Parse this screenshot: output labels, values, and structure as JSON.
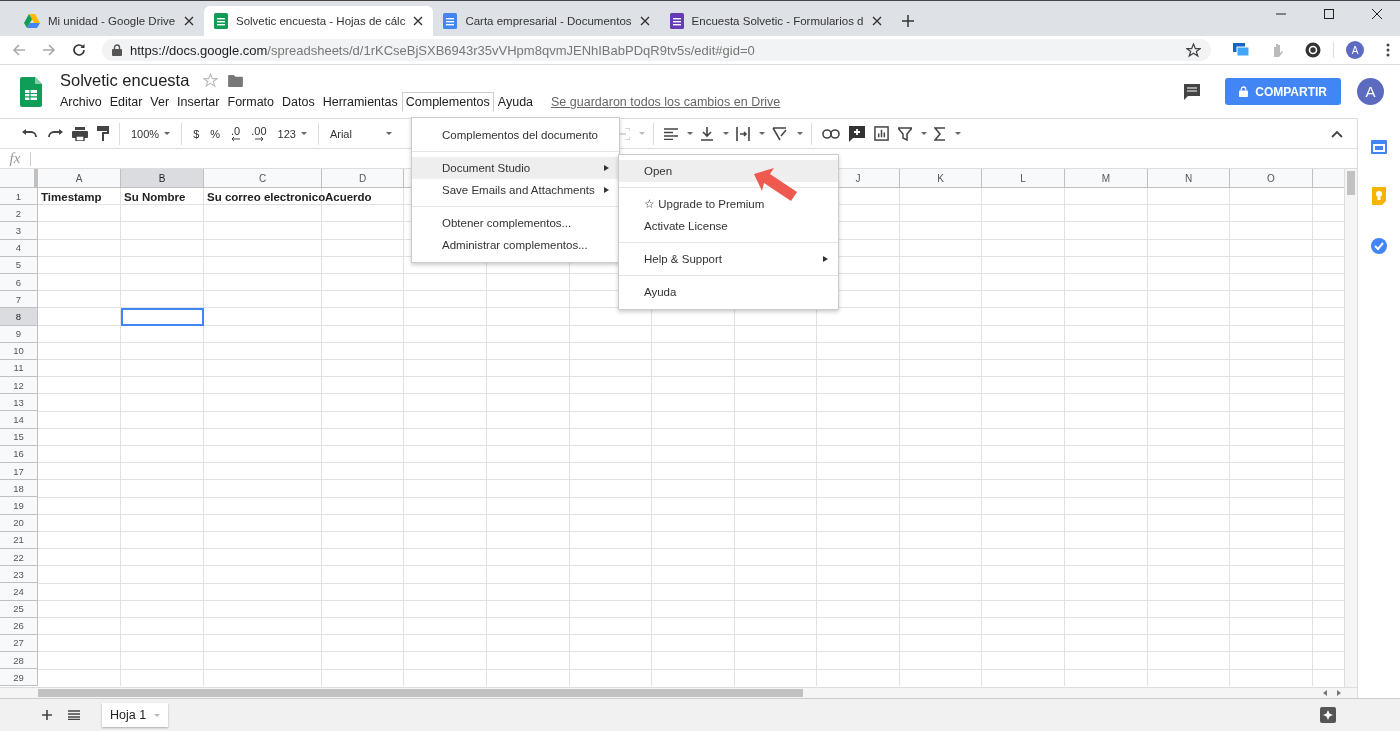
{
  "browser": {
    "tabs": [
      {
        "kind": "drive",
        "title": "Mi unidad - Google Drive",
        "selected": false
      },
      {
        "kind": "sheets",
        "title": "Solvetic encuesta - Hojas de cálc",
        "selected": true
      },
      {
        "kind": "docs",
        "title": "Carta empresarial - Documentos",
        "selected": false
      },
      {
        "kind": "forms",
        "title": "Encuesta Solvetic - Formularios d",
        "selected": false
      }
    ],
    "address": {
      "host": "https://docs.google.com",
      "path": "/spreadsheets/d/1rKCseBjSXB6943r35vVHpm8qvmJENhIBabPDqR9tv5s/edit#gid=0"
    },
    "profile": "A"
  },
  "app": {
    "title": "Solvetic encuesta",
    "menu": [
      {
        "label": "Archivo",
        "open": false
      },
      {
        "label": "Editar",
        "open": false
      },
      {
        "label": "Ver",
        "open": false
      },
      {
        "label": "Insertar",
        "open": false
      },
      {
        "label": "Formato",
        "open": false
      },
      {
        "label": "Datos",
        "open": false
      },
      {
        "label": "Herramientas",
        "open": false
      },
      {
        "label": "Complementos",
        "open": true
      },
      {
        "label": "Ayuda",
        "open": false
      }
    ],
    "save_status": "Se guardaron todos los cambios en Drive",
    "share_button": "COMPARTIR",
    "avatar": "A"
  },
  "toolbar": {
    "zoom": "100%",
    "currency": "$",
    "percent": "%",
    "decrease_decimals": ".0",
    "increase_decimals": ".00",
    "number_format": "123",
    "font": "Arial"
  },
  "formula_bar": {
    "label": "fx"
  },
  "grid": {
    "columns": [
      {
        "label": "A",
        "selected": false
      },
      {
        "label": "B",
        "selected": true
      },
      {
        "label": "C",
        "selected": false
      },
      {
        "label": "D",
        "selected": false
      },
      {
        "covered": true
      },
      {
        "label": "J",
        "selected": false
      },
      {
        "label": "K",
        "selected": false
      },
      {
        "label": "L",
        "selected": false
      },
      {
        "label": "M",
        "selected": false
      },
      {
        "label": "N",
        "selected": false
      },
      {
        "label": "O",
        "selected": false
      },
      {
        "covered": true
      }
    ],
    "rows": [
      {
        "number": "1",
        "selected": false,
        "bold": true,
        "cells": [
          "Timestamp",
          "Su Nombre",
          "Su correo electronico",
          "Acuerdo"
        ]
      },
      {
        "number": "2",
        "selected": false
      },
      {
        "number": "3",
        "selected": false
      },
      {
        "number": "4",
        "selected": false
      },
      {
        "number": "5",
        "selected": false
      },
      {
        "number": "6",
        "selected": false
      },
      {
        "number": "7",
        "selected": false
      },
      {
        "number": "8",
        "selected": true
      },
      {
        "number": "9",
        "selected": false
      },
      {
        "number": "10",
        "selected": false
      },
      {
        "number": "11",
        "selected": false
      },
      {
        "number": "12",
        "selected": false
      },
      {
        "number": "13",
        "selected": false
      },
      {
        "number": "14",
        "selected": false
      },
      {
        "number": "15",
        "selected": false
      },
      {
        "number": "16",
        "selected": false
      },
      {
        "number": "17",
        "selected": false
      },
      {
        "number": "18",
        "selected": false
      },
      {
        "number": "19",
        "selected": false
      },
      {
        "number": "20",
        "selected": false
      },
      {
        "number": "21",
        "selected": false
      },
      {
        "number": "22",
        "selected": false
      },
      {
        "number": "23",
        "selected": false
      },
      {
        "number": "24",
        "selected": false
      },
      {
        "number": "25",
        "selected": false
      },
      {
        "number": "26",
        "selected": false
      },
      {
        "number": "27",
        "selected": false
      },
      {
        "number": "28",
        "selected": false
      },
      {
        "number": "29",
        "selected": false
      }
    ]
  },
  "addon_menu": {
    "items": [
      {
        "kind": "item",
        "label": "Complementos del documento",
        "highlighted": false,
        "has_submenu": false
      },
      {
        "kind": "separator"
      },
      {
        "kind": "item",
        "label": "Document Studio",
        "highlighted": true,
        "has_submenu": true
      },
      {
        "kind": "item",
        "label": "Save Emails and Attachments",
        "highlighted": false,
        "has_submenu": true
      },
      {
        "kind": "separator"
      },
      {
        "kind": "item",
        "label": "Obtener complementos...",
        "highlighted": false,
        "has_submenu": false
      },
      {
        "kind": "item",
        "label": "Administrar complementos...",
        "highlighted": false,
        "has_submenu": false
      }
    ]
  },
  "submenu": {
    "items": [
      {
        "kind": "item",
        "label": "Open",
        "highlighted": true,
        "has_submenu": false
      },
      {
        "kind": "separator"
      },
      {
        "kind": "item",
        "label": "☆ Upgrade to Premium",
        "highlighted": false,
        "has_submenu": false
      },
      {
        "kind": "item",
        "label": "Activate License",
        "highlighted": false,
        "has_submenu": false
      },
      {
        "kind": "separator"
      },
      {
        "kind": "item",
        "label": "Help & Support",
        "highlighted": false,
        "has_submenu": true
      },
      {
        "kind": "separator"
      },
      {
        "kind": "item",
        "label": "Ayuda",
        "highlighted": false,
        "has_submenu": false
      }
    ]
  },
  "annotation": {
    "kind": "arrow"
  },
  "sheets": [
    {
      "label": "Hoja 1",
      "selected": true
    }
  ]
}
